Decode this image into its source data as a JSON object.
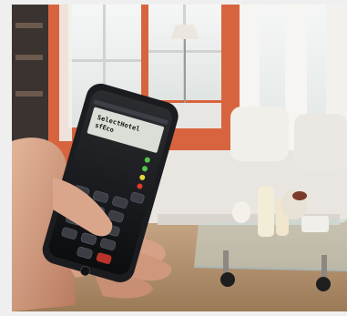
{
  "phone_screen": {
    "display_line1": "SelectHotel",
    "display_line2": "sfEco"
  },
  "colors": {
    "wall": "#d8643f",
    "window_light": "#eef2f2",
    "floor": "#b3916c",
    "sofa": "#e9e6e1",
    "phone_body": "#1b1c1f",
    "led_green": "#55c24a",
    "led_red": "#e23a2a",
    "page_border": "#efefef"
  }
}
